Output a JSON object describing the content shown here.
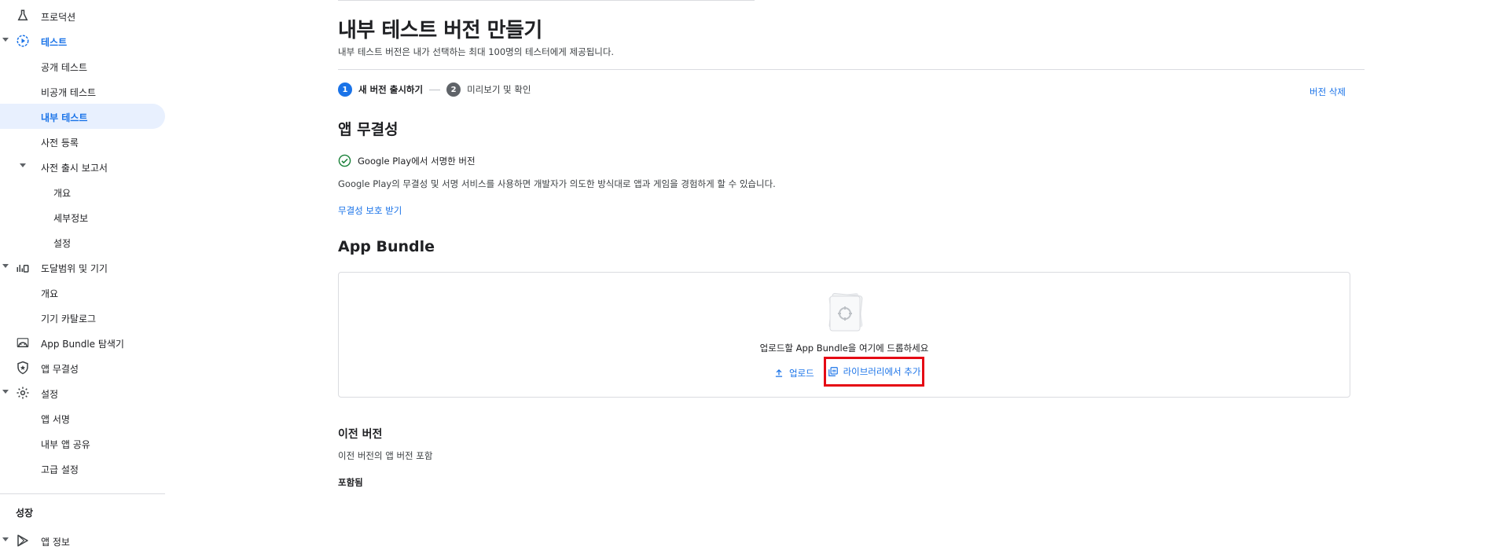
{
  "sidebar": {
    "items": [
      {
        "label": "프로덕션",
        "icon": "flask-icon"
      },
      {
        "label": "테스트",
        "icon": "play-circle-icon"
      },
      {
        "label": "공개 테스트"
      },
      {
        "label": "비공개 테스트"
      },
      {
        "label": "내부 테스트"
      },
      {
        "label": "사전 등록"
      },
      {
        "label": "사전 출시 보고서"
      },
      {
        "label": "개요"
      },
      {
        "label": "세부정보"
      },
      {
        "label": "설정"
      },
      {
        "label": "도달범위 및 기기",
        "icon": "bar-chart-device-icon"
      },
      {
        "label": "개요"
      },
      {
        "label": "기기 카탈로그"
      },
      {
        "label": "App Bundle 탐색기",
        "icon": "android-bundle-icon"
      },
      {
        "label": "앱 무결성",
        "icon": "shield-star-icon"
      },
      {
        "label": "설정",
        "icon": "gear-icon"
      },
      {
        "label": "앱 서명"
      },
      {
        "label": "내부 앱 공유"
      },
      {
        "label": "고급 설정"
      },
      {
        "label": "앱 정보",
        "icon": "play-store-icon"
      }
    ],
    "section_heading": "성장"
  },
  "main": {
    "title": "내부 테스트 버전 만들기",
    "subtitle": "내부 테스트 버전은 내가 선택하는 최대 100명의 테스터에게 제공됩니다.",
    "steps": [
      {
        "number": "1",
        "label": "새 버전 출시하기"
      },
      {
        "number": "2",
        "label": "미리보기 및 확인"
      }
    ],
    "delete_link": "버전 삭제",
    "integrity": {
      "title": "앱 무결성",
      "status": "Google Play에서 서명한 버전",
      "description": "Google Play의 무결성 및 서명 서비스를 사용하면 개발자가 의도한 방식대로 앱과 게임을 경험하게 할 수 있습니다.",
      "link": "무결성 보호 받기"
    },
    "bundle": {
      "title": "App Bundle",
      "drop_text": "업로드할 App Bundle을 여기에 드롭하세요",
      "upload_button": "업로드",
      "library_button": "라이브러리에서 추가"
    },
    "previous": {
      "title": "이전 버전",
      "description": "이전 버전의 앱 버전 포함",
      "status": "포함됨"
    }
  },
  "colors": {
    "accent": "#1a73e8",
    "active_bg": "#e8f0fe",
    "highlight": "#e50914",
    "success": "#188038"
  }
}
